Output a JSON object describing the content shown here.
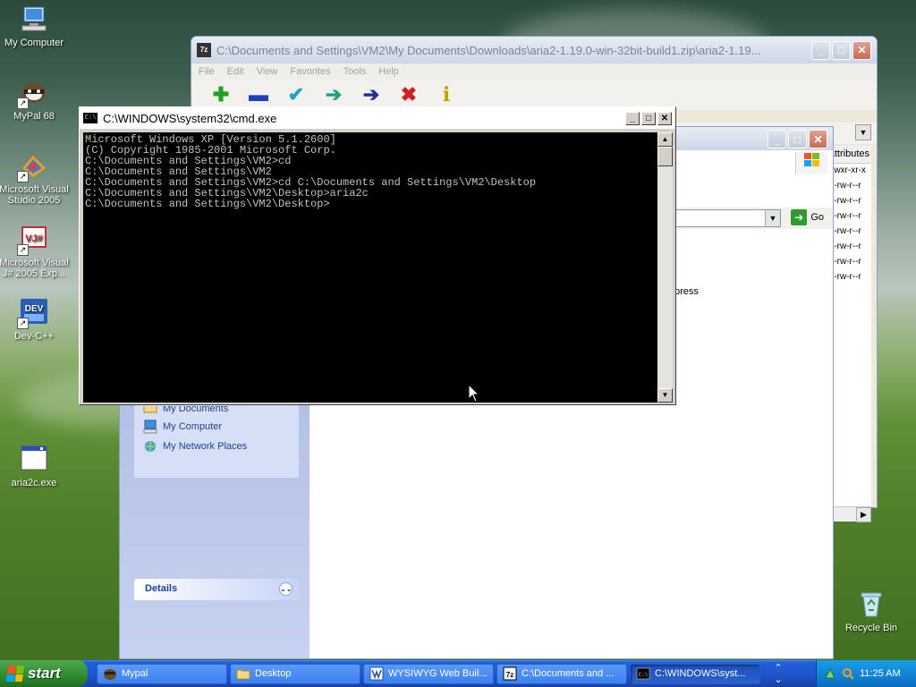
{
  "desktop": {
    "icons": [
      {
        "label": "My Computer",
        "icon": "computer-icon"
      },
      {
        "label": "MyPal 68",
        "icon": "mypal-icon"
      },
      {
        "label": "Microsoft Visual Studio 2005",
        "icon": "visual-studio-icon"
      },
      {
        "label": "Microsoft Visual J# 2005 Exp...",
        "icon": "visual-jsharp-icon"
      },
      {
        "label": "Dev-C++",
        "icon": "devcpp-icon"
      },
      {
        "label": "aria2c.exe",
        "icon": "exe-icon"
      },
      {
        "label": "Recycle Bin",
        "icon": "recycle-bin-icon"
      }
    ]
  },
  "sevenzip": {
    "title": "C:\\Documents and Settings\\VM2\\My Documents\\Downloads\\aria2-1.19.0-win-32bit-build1.zip\\aria2-1.19...",
    "app_icon": "7z",
    "menu": [
      "File",
      "Edit",
      "View",
      "Favorites",
      "Tools",
      "Help"
    ],
    "toolbar": [
      {
        "name": "add",
        "glyph": "✚",
        "color": "#20a020"
      },
      {
        "name": "extract",
        "glyph": "▬",
        "color": "#1f3fbf"
      },
      {
        "name": "test",
        "glyph": "✔",
        "color": "#20a0c0"
      },
      {
        "name": "copy",
        "glyph": "➔",
        "color": "#20a080"
      },
      {
        "name": "move",
        "glyph": "➔",
        "color": "#1f2f9f"
      },
      {
        "name": "delete",
        "glyph": "✖",
        "color": "#d02020"
      },
      {
        "name": "info",
        "glyph": "i",
        "color": "#c0a000"
      }
    ],
    "list_header": "Attributes",
    "attributes": [
      "rwxr-xr-x",
      "rw-r--r--",
      "rw-r--r--",
      "rw-r--r--",
      "rw-r--r--",
      "rw-r--r--",
      "rw-r--r--",
      "rw-r--r--"
    ]
  },
  "explorer": {
    "go_label": "Go",
    "partial_text": "press",
    "other_places": [
      {
        "label": "My Documents",
        "icon": "my-documents-icon"
      },
      {
        "label": "My Computer",
        "icon": "computer-icon"
      },
      {
        "label": "My Network Places",
        "icon": "network-places-icon"
      }
    ],
    "details_label": "Details"
  },
  "cmd": {
    "title": "C:\\WINDOWS\\system32\\cmd.exe",
    "lines": [
      "Microsoft Windows XP [Version 5.1.2600]",
      "(C) Copyright 1985-2001 Microsoft Corp.",
      "",
      "C:\\Documents and Settings\\VM2>cd",
      "C:\\Documents and Settings\\VM2",
      "",
      "C:\\Documents and Settings\\VM2>cd C:\\Documents and Settings\\VM2\\Desktop",
      "",
      "C:\\Documents and Settings\\VM2\\Desktop>aria2c",
      "",
      "C:\\Documents and Settings\\VM2\\Desktop>"
    ]
  },
  "taskbar": {
    "start_label": "start",
    "tasks": [
      {
        "label": "Mypal",
        "icon": "mypal-icon",
        "active": false
      },
      {
        "label": "Desktop",
        "icon": "folder-icon",
        "active": false
      },
      {
        "label": "WYSIWYG Web Buil...",
        "icon": "wysiwyg-icon",
        "active": false
      },
      {
        "label": "C:\\Documents and ...",
        "icon": "sevenzip-icon",
        "active": false
      },
      {
        "label": "C:\\WINDOWS\\syst...",
        "icon": "cmd-icon",
        "active": true
      }
    ],
    "clock": "11:25 AM"
  }
}
